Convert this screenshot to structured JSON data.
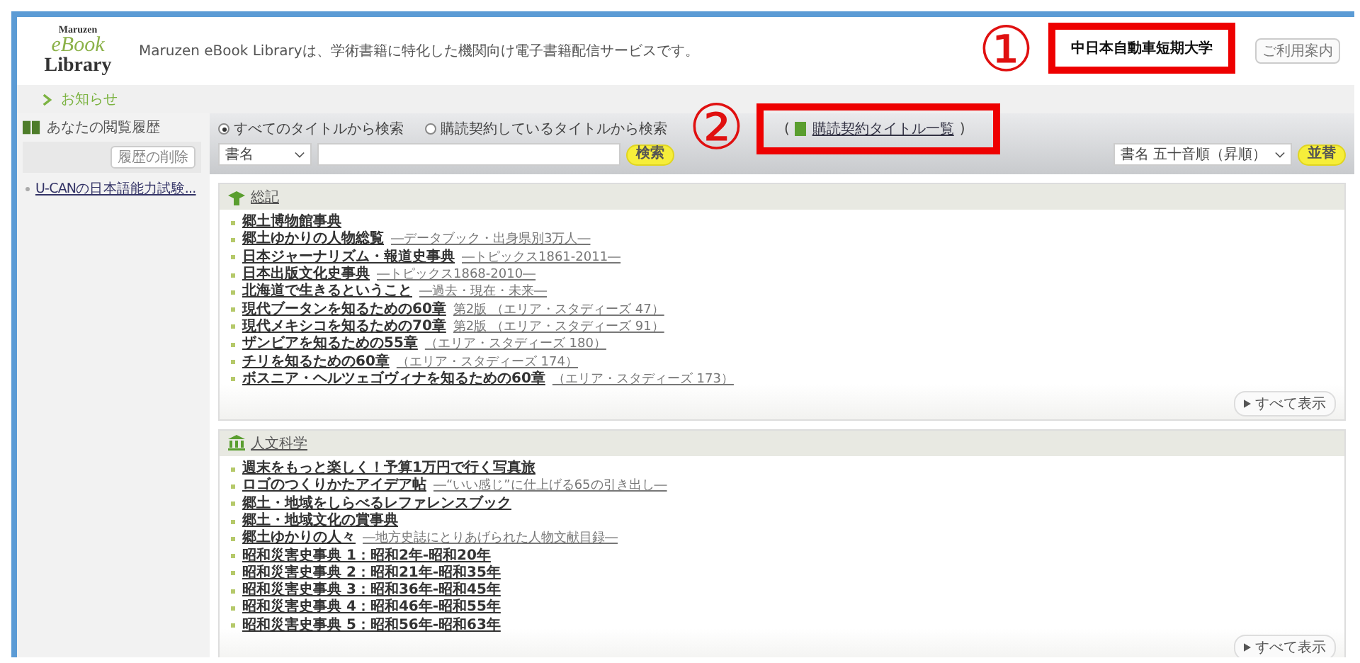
{
  "header": {
    "logo": {
      "maker": "Maruzen",
      "name": "eBook",
      "sub": "Library"
    },
    "tagline": "Maruzen eBook Libraryは、学術書籍に特化した機関向け電子書籍配信サービスです。",
    "institution": "中日本自動車短期大学",
    "buttons": [
      "ご利用案内"
    ]
  },
  "notice_link": "お知らせ",
  "sidebar": {
    "heading": "あなたの閲覧履歴",
    "clear_button": "履歴の削除",
    "items": [
      "U-CANの日本語能力試験..."
    ]
  },
  "search": {
    "scopes": [
      {
        "label": "すべてのタイトルから検索",
        "selected": true
      },
      {
        "label": "購読契約しているタイトルから検索",
        "selected": false
      }
    ],
    "paren_open": "(",
    "list_link": "購読契約タイトル一覧",
    "paren_close": ")",
    "field_select": "書名",
    "search_button": "検索",
    "sort_select": "書名 五十音順（昇順）",
    "sort_button": "並替"
  },
  "sections": [
    {
      "title": "総記",
      "show_all": "すべて表示",
      "items": [
        {
          "title": "郷土博物館事典"
        },
        {
          "title": "郷土ゆかりの人物総覧",
          "subtitle": "―データブック・出身県別3万人―"
        },
        {
          "title": "日本ジャーナリズム・報道史事典",
          "subtitle": "―トピックス1861-2011―"
        },
        {
          "title": "日本出版文化史事典",
          "subtitle": "―トピックス1868-2010―"
        },
        {
          "title": "北海道で生きるということ",
          "subtitle": "―過去・現在・未来―"
        },
        {
          "title": "現代ブータンを知るための60章",
          "subtitle": "第2版 （エリア・スタディーズ 47）"
        },
        {
          "title": "現代メキシコを知るための70章",
          "subtitle": "第2版 （エリア・スタディーズ 91）"
        },
        {
          "title": "ザンビアを知るための55章",
          "subtitle": "（エリア・スタディーズ 180）"
        },
        {
          "title": "チリを知るための60章",
          "subtitle": "（エリア・スタディーズ 174）"
        },
        {
          "title": "ボスニア・ヘルツェゴヴィナを知るための60章",
          "subtitle": "（エリア・スタディーズ 173）"
        }
      ]
    },
    {
      "title": "人文科学",
      "show_all": "すべて表示",
      "items": [
        {
          "title": "週末をもっと楽しく！予算1万円で行く写真旅"
        },
        {
          "title": "ロゴのつくりかたアイデア帖",
          "subtitle": "―“いい感じ”に仕上げる65の引き出し―"
        },
        {
          "title": "郷土・地域をしらべるレファレンスブック"
        },
        {
          "title": "郷土・地域文化の賞事典"
        },
        {
          "title": "郷土ゆかりの人々",
          "subtitle": "―地方史誌にとりあげられた人物文献目録―"
        },
        {
          "title": "昭和災害史事典 1：昭和2年-昭和20年"
        },
        {
          "title": "昭和災害史事典 2：昭和21年-昭和35年"
        },
        {
          "title": "昭和災害史事典 3：昭和36年-昭和45年"
        },
        {
          "title": "昭和災害史事典 4：昭和46年-昭和55年"
        },
        {
          "title": "昭和災害史事典 5：昭和56年-昭和63年"
        }
      ]
    }
  ],
  "annotations": [
    {
      "label": "①"
    },
    {
      "label": "②"
    }
  ]
}
